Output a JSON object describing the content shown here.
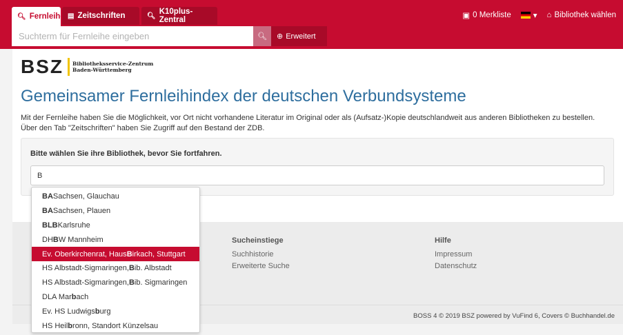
{
  "tabs": [
    {
      "label": "Fernleihe",
      "icon": "search-icon"
    },
    {
      "label": "Zeitschriften",
      "icon": "newspaper-icon"
    },
    {
      "label": "K10plus-Zentral",
      "icon": "search-icon"
    }
  ],
  "search": {
    "placeholder": "Suchterm für Fernleihe eingeben",
    "advanced_label": "Erweitert"
  },
  "topnav": {
    "merkliste": "0 Merkliste",
    "bibliothek": "Bibliothek wählen"
  },
  "logo": {
    "mark": "BSZ",
    "line1": "Bibliotheksservice-Zentrum",
    "line2": "Baden-Württemberg"
  },
  "page": {
    "title": "Gemeinsamer Fernleihindex der deutschen Verbundsysteme",
    "intro1": "Mit der Fernleihe haben Sie die Möglichkeit, vor Ort nicht vorhandene Literatur im Original oder als (Aufsatz-)Kopie deutschlandweit aus anderen Bibliotheken zu bestellen.",
    "intro2": "Über den Tab \"Zeitschriften\" haben Sie Zugriff auf den Bestand der ZDB.",
    "panel_label": "Bitte wählen Sie ihre Bibliothek, bevor Sie fortfahren.",
    "input_value": "B"
  },
  "dropdown": [
    {
      "bold": "BA",
      "rest": " Sachsen, Glauchau"
    },
    {
      "bold": "BA",
      "rest": " Sachsen, Plauen"
    },
    {
      "bold": "BLB",
      "rest": " Karlsruhe"
    },
    {
      "pre": "DH",
      "bold": "B",
      "rest": "W Mannheim"
    },
    {
      "pre": "Ev. Oberkirchenrat, Haus ",
      "bold": "B",
      "rest": "irkach, Stuttgart",
      "selected": true
    },
    {
      "pre": "HS Albstadt-Sigmaringen, ",
      "bold": "B",
      "rest": "ib. Albstadt"
    },
    {
      "pre": "HS Albstadt-Sigmaringen, ",
      "bold": "B",
      "rest": "ib. Sigmaringen"
    },
    {
      "pre": "DLA Mar",
      "bold": "b",
      "rest": "ach"
    },
    {
      "pre": "Ev. HS Ludwigs",
      "bold": "b",
      "rest": "urg"
    },
    {
      "pre": "HS Heil",
      "bold": "b",
      "rest": "ronn, Standort Künzelsau"
    }
  ],
  "footer": {
    "col2_head": "Sucheinstiege",
    "col2_links": [
      "Suchhistorie",
      "Erweiterte Suche"
    ],
    "col3_head": "Hilfe",
    "col3_links": [
      "Impressum",
      "Datenschutz"
    ],
    "copyright": "BOSS 4 © 2019 BSZ powered by VuFind 6, Covers © Buchhandel.de"
  },
  "colors": {
    "brand": "#c60c30",
    "title": "#2e6e9e"
  }
}
